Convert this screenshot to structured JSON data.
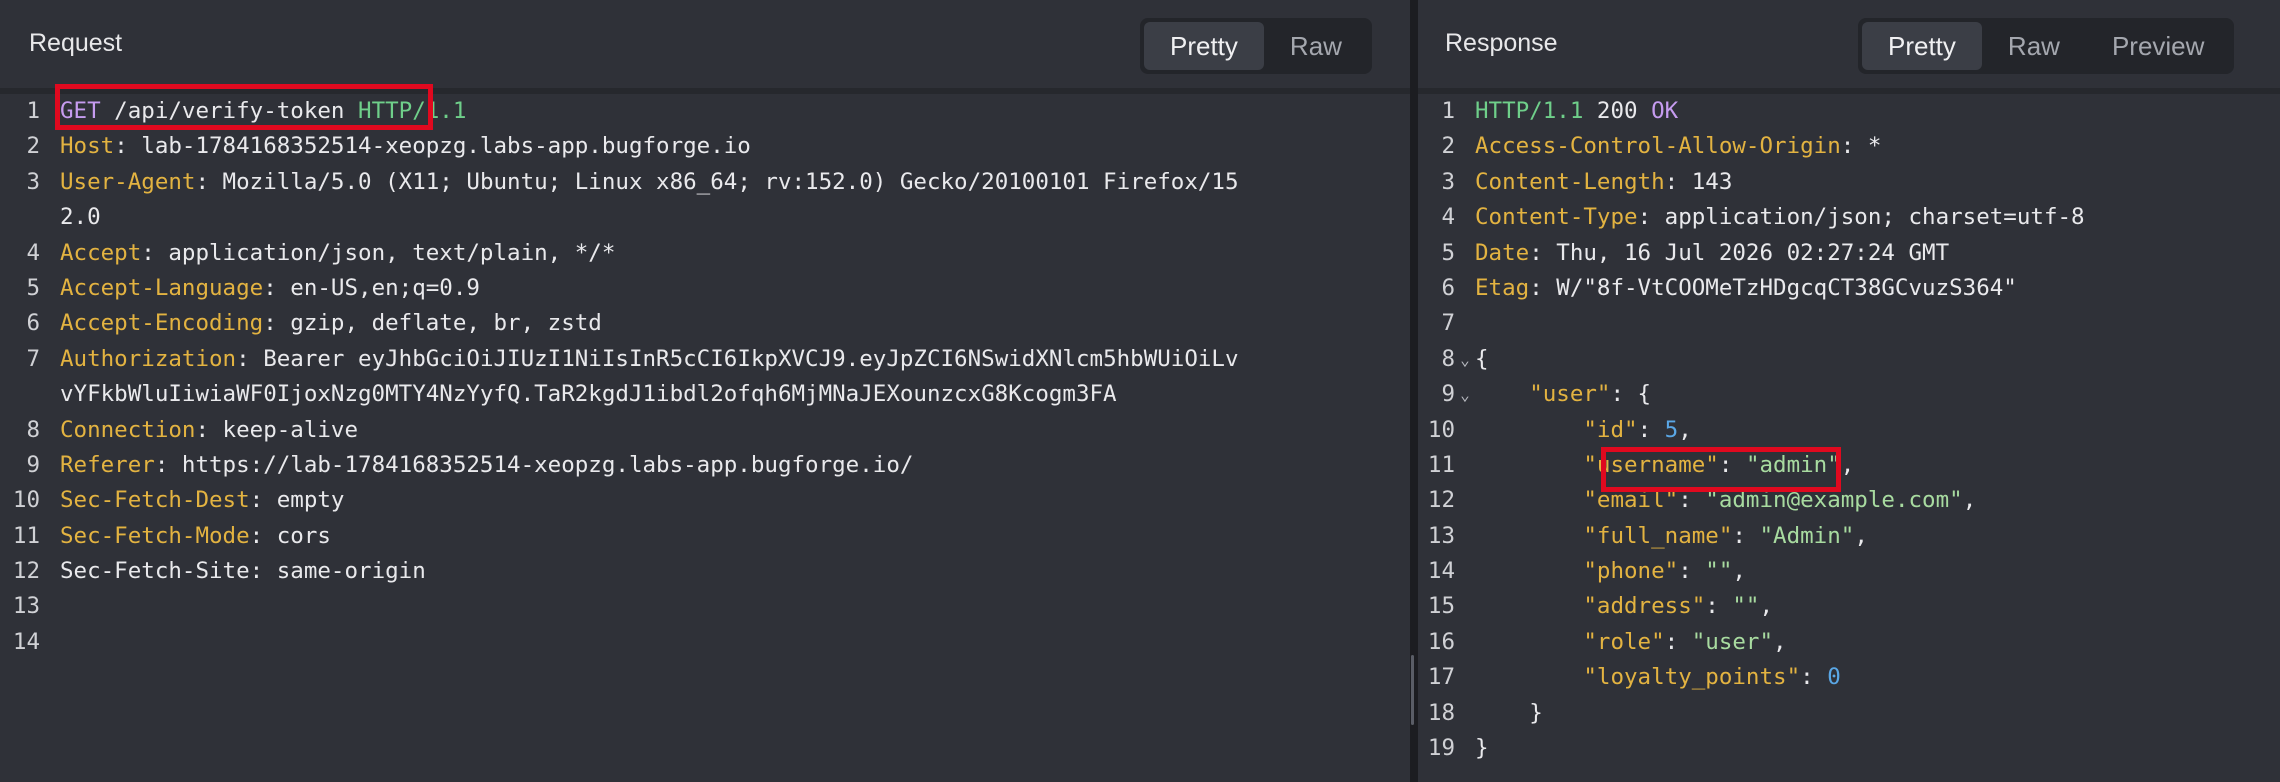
{
  "request": {
    "title": "Request",
    "tabs": [
      {
        "label": "Pretty",
        "active": true
      },
      {
        "label": "Raw",
        "active": false
      }
    ],
    "lines": [
      {
        "num": "1",
        "method": "GET",
        "path": " /api/verify-token ",
        "proto": "HTTP/1.1"
      },
      {
        "num": "2",
        "key": "Host",
        "value": ": lab-1784168352514-xeopzg.labs-app.bugforge.io"
      },
      {
        "num": "3",
        "key": "User-Agent",
        "value": ": Mozilla/5.0 (X11; Ubuntu; Linux x86_64; rv:152.0) Gecko/20100101 Firefox/15"
      },
      {
        "num": "",
        "value": "2.0"
      },
      {
        "num": "4",
        "key": "Accept",
        "value": ": application/json, text/plain, */*"
      },
      {
        "num": "5",
        "key": "Accept-Language",
        "value": ": en-US,en;q=0.9"
      },
      {
        "num": "6",
        "key": "Accept-Encoding",
        "value": ": gzip, deflate, br, zstd"
      },
      {
        "num": "7",
        "key": "Authorization",
        "value": ": Bearer eyJhbGciOiJIUzI1NiIsInR5cCI6IkpXVCJ9.eyJpZCI6NSwidXNlcm5hbWUiOiLv"
      },
      {
        "num": "",
        "value": "vYFkbWluIiwiaWF0IjoxNzg0MTY4NzYyfQ.TaR2kgdJ1ibdl2ofqh6MjMNaJEXounzcxG8Kcogm3FA"
      },
      {
        "num": "8",
        "key": "Connection",
        "value": ": keep-alive"
      },
      {
        "num": "9",
        "key": "Referer",
        "value": ": https://lab-1784168352514-xeopzg.labs-app.bugforge.io/"
      },
      {
        "num": "10",
        "key": "Sec-Fetch-Dest",
        "value": ": empty"
      },
      {
        "num": "11",
        "key": "Sec-Fetch-Mode",
        "value": ": cors"
      },
      {
        "num": "12",
        "key": "Sec-Fetch-Site",
        "value": ": same-origin"
      },
      {
        "num": "13"
      },
      {
        "num": "14"
      }
    ]
  },
  "response": {
    "title": "Response",
    "tabs": [
      {
        "label": "Pretty",
        "active": true
      },
      {
        "label": "Raw",
        "active": false
      },
      {
        "label": "Preview",
        "active": false
      }
    ],
    "status": {
      "proto": "HTTP/1.1",
      "code": " 200 ",
      "text": "OK"
    },
    "headers": [
      {
        "num": "2",
        "key": "Access-Control-Allow-Origin",
        "value": ": *"
      },
      {
        "num": "3",
        "key": "Content-Length",
        "value": ": 143"
      },
      {
        "num": "4",
        "key": "Content-Type",
        "value": ": application/json; charset=utf-8"
      },
      {
        "num": "5",
        "key": "Date",
        "value": ": Thu, 16 Jul 2026 02:27:24 GMT"
      },
      {
        "num": "6",
        "key": "Etag",
        "value": ": W/\"8f-VtCOOMeTzHDgcqCT38GCvuzS364\""
      }
    ],
    "body": {
      "open_brace": "{",
      "user_key": "\"user\"",
      "user_open": ": {",
      "fields": [
        {
          "num": "10",
          "key": "\"id\"",
          "sep": ": ",
          "value": "5",
          "type": "number",
          "comma": ","
        },
        {
          "num": "11",
          "key": "\"username\"",
          "sep": ": ",
          "value": "\"admin\"",
          "type": "string",
          "comma": ","
        },
        {
          "num": "12",
          "key": "\"email\"",
          "sep": ": ",
          "value": "\"admin@example.com\"",
          "type": "string",
          "comma": ","
        },
        {
          "num": "13",
          "key": "\"full_name\"",
          "sep": ": ",
          "value": "\"Admin\"",
          "type": "string",
          "comma": ","
        },
        {
          "num": "14",
          "key": "\"phone\"",
          "sep": ": ",
          "value": "\"\"",
          "type": "string",
          "comma": ","
        },
        {
          "num": "15",
          "key": "\"address\"",
          "sep": ": ",
          "value": "\"\"",
          "type": "string",
          "comma": ","
        },
        {
          "num": "16",
          "key": "\"role\"",
          "sep": ": ",
          "value": "\"user\"",
          "type": "string",
          "comma": ","
        },
        {
          "num": "17",
          "key": "\"loyalty_points\"",
          "sep": ": ",
          "value": "0",
          "type": "number",
          "comma": ""
        }
      ],
      "user_close": "}",
      "close_brace": "}"
    },
    "fold_icon": "chevron-down",
    "line_numbers": {
      "status": "1",
      "blank": "7",
      "open": "8",
      "user": "9",
      "user_close": "18",
      "close": "19"
    }
  },
  "colors": {
    "highlight_box": "#e0091f",
    "header_key": "#e3b341",
    "method": "#c69cf0",
    "protocol": "#6fcf8a",
    "string": "#a8dba0",
    "number": "#5aa7e6"
  }
}
